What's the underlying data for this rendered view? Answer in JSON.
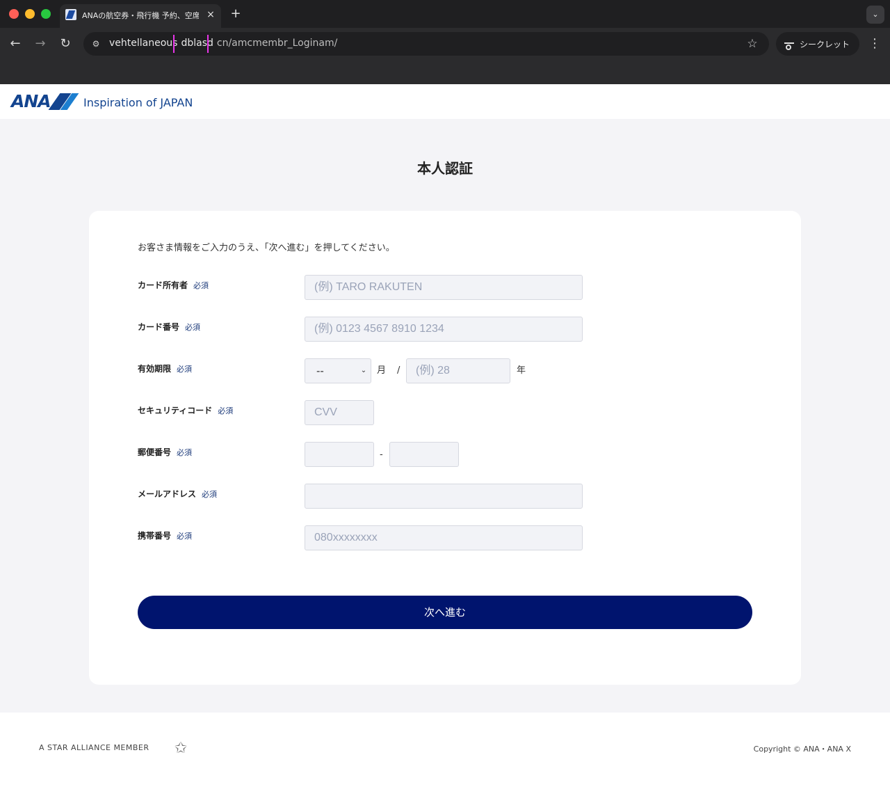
{
  "browser": {
    "tab_title": "ANAの航空券・飛行機 予約、空席",
    "tab_close": "×",
    "new_tab": "+",
    "tab_menu": "⌄",
    "url_part1": "vehtellaneous",
    "url_part2": "dblasd",
    "url_part3": "cn/amcmembr_Loginam/",
    "incognito_label": "シークレット"
  },
  "header": {
    "logo_text": "ANA",
    "tagline": "Inspiration of JAPAN"
  },
  "main": {
    "title": "本人認証",
    "intro": "お客さま情報をご入力のうえ、「次へ進む」を押してください。",
    "required_badge": "必須",
    "fields": {
      "card_holder": {
        "label": "カード所有者",
        "placeholder": "(例) TARO RAKUTEN"
      },
      "card_number": {
        "label": "カード番号",
        "placeholder": "(例) 0123 4567 8910 1234"
      },
      "expiry": {
        "label": "有効期限",
        "month_value": "--",
        "month_unit": "月",
        "separator": "/",
        "year_placeholder": "(例) 28",
        "year_unit": "年"
      },
      "security_code": {
        "label": "セキュリティコード",
        "placeholder": "CVV"
      },
      "postal_code": {
        "label": "郵便番号",
        "separator": "-"
      },
      "email": {
        "label": "メールアドレス"
      },
      "mobile": {
        "label": "携帯番号",
        "placeholder": "080xxxxxxxx"
      }
    },
    "submit_label": "次へ進む"
  },
  "footer": {
    "star_alliance": "A STAR ALLIANCE MEMBER",
    "copyright": "Copyright © ANA・ANA X"
  }
}
